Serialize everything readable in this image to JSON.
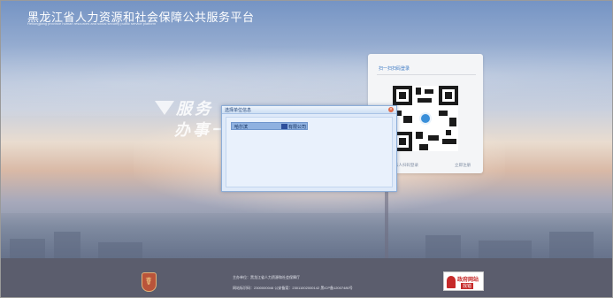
{
  "header": {
    "title": "黑龙江省人力资源和社会保障公共服务平台",
    "subtitle": "Heilongjiang province human resources and social security public service platform"
  },
  "slogan": {
    "line1": "服务",
    "line2": "办事一"
  },
  "login": {
    "heading": "扫一扫扫码登录",
    "link_left": "法人扫码登录",
    "link_right": "立即注册"
  },
  "dialog": {
    "title": "选择单位信息",
    "close_glyph": "×",
    "units": [
      {
        "name_left": "哈尔滨",
        "name_right": "有限公司"
      }
    ]
  },
  "footer": {
    "host": "主办单位：黑龙江省人力资源和社会保障厅",
    "record": "网站标识码：2300000046  公安备案：23011002000142  黑ICP备12007480号",
    "emblem_glyph": "☤",
    "gov_badge_top": "政府网站",
    "gov_badge_bottom": "找错"
  },
  "colors": {
    "accent": "#3a78c4",
    "footer_bg": "#5b5d6d",
    "dialog_bg": "#dfeaf9",
    "selection": "#8fb1e0"
  }
}
